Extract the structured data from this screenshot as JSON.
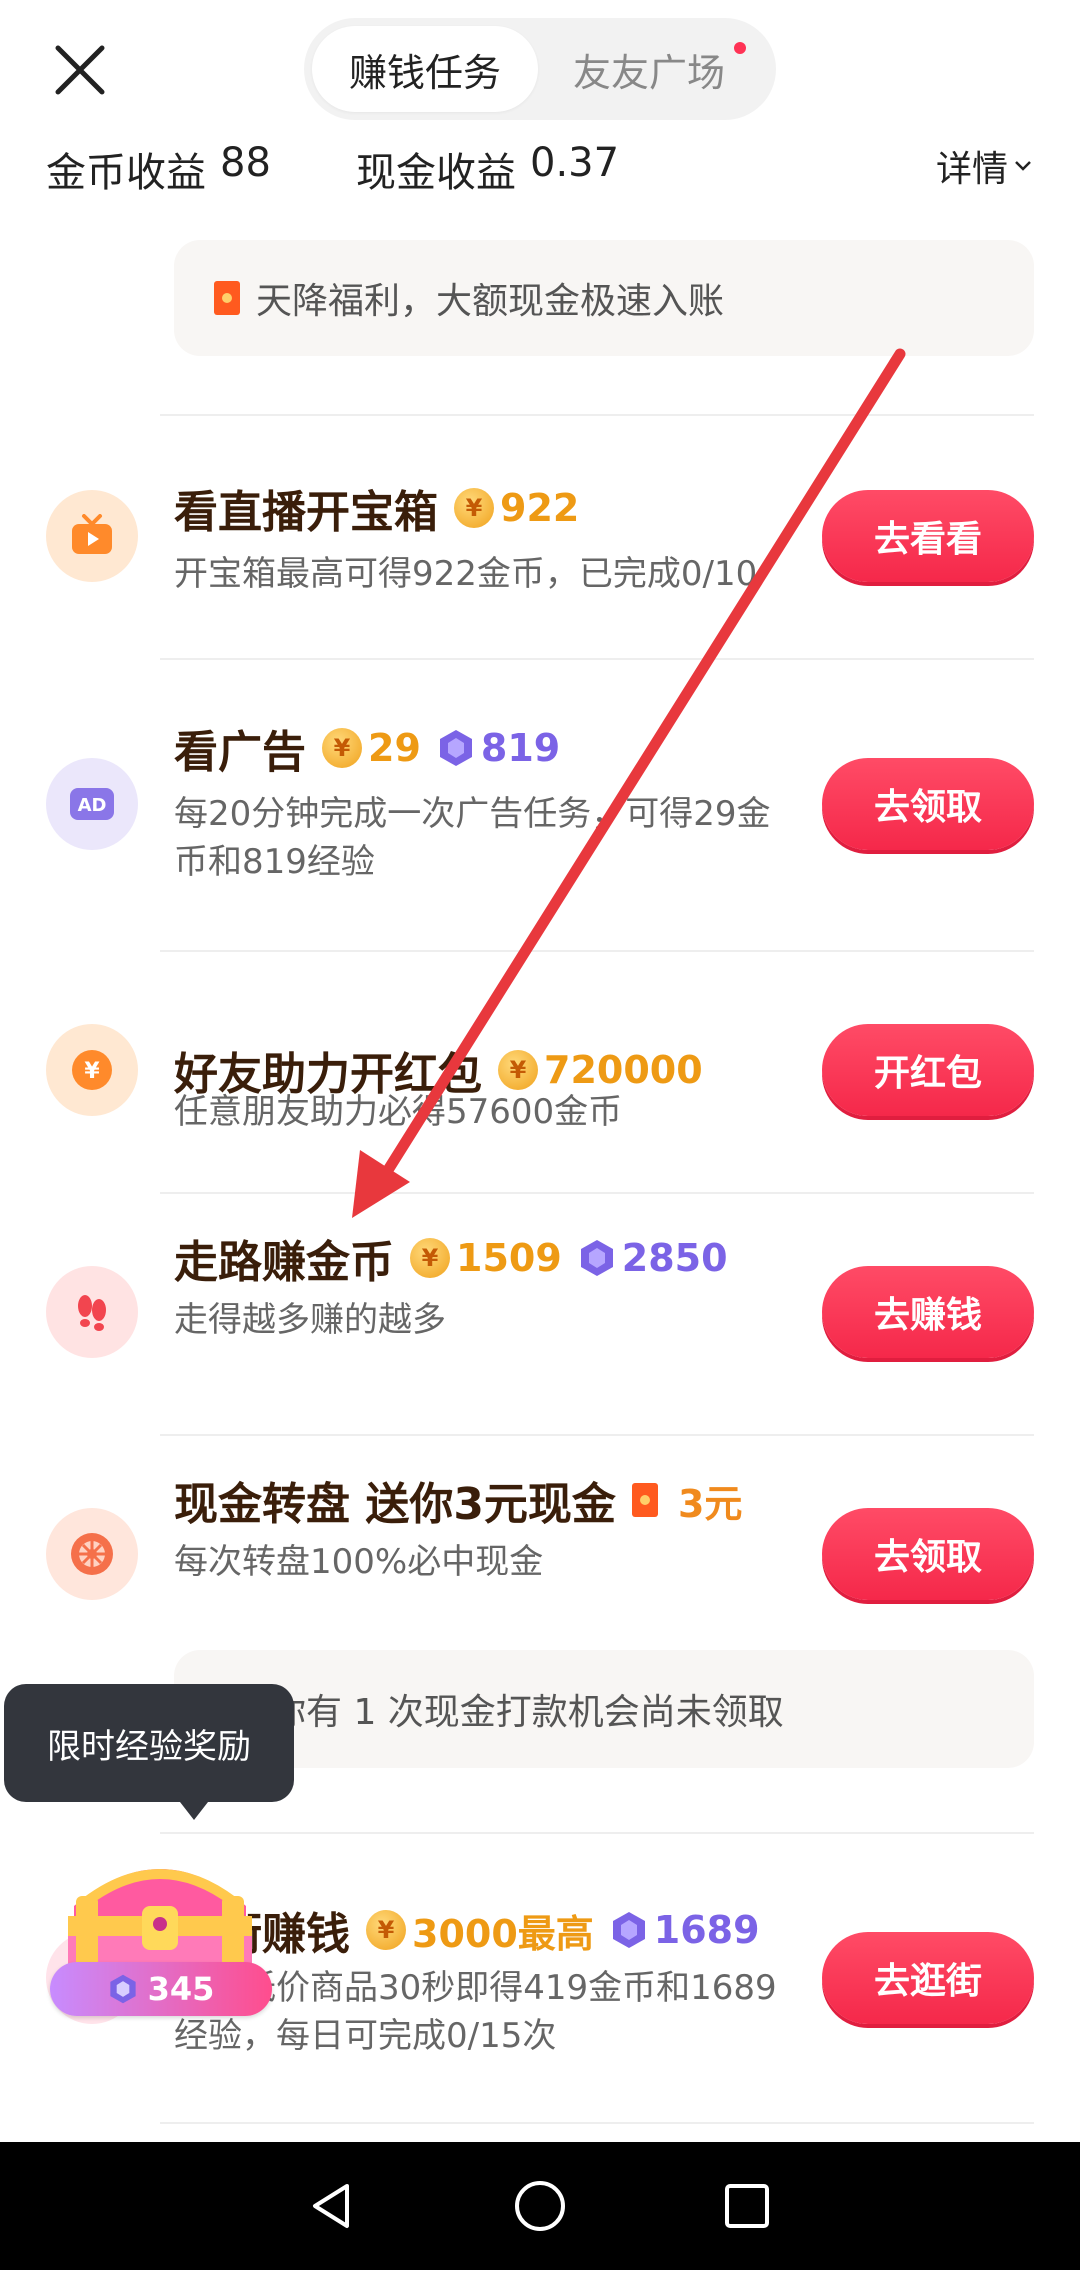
{
  "header": {
    "tabs": [
      {
        "label": "赚钱任务",
        "active": true
      },
      {
        "label": "友友广场",
        "active": false,
        "has_dot": true
      }
    ]
  },
  "earnings": {
    "gold_label": "金币收益",
    "gold_value": "88",
    "cash_label": "现金收益",
    "cash_value": "0.37",
    "detail_label": "详情"
  },
  "notice_top": "天降福利，大额现金极速入账",
  "tasks": [
    {
      "title": "看直播开宝箱",
      "coins": "922",
      "desc": "开宝箱最高可得922金币，已完成0/10",
      "button": "去看看",
      "icon": "tv-icon"
    },
    {
      "title": "看广告",
      "coins": "29",
      "exp": "819",
      "desc": "每20分钟完成一次广告任务，可得29金币和819经验",
      "button": "去领取",
      "icon": "ad-icon"
    },
    {
      "title": "好友助力开红包",
      "coins": "720000",
      "desc": "任意朋友助力必得57600金币",
      "button": "开红包",
      "icon": "yuan-icon"
    },
    {
      "title": "走路赚金币",
      "coins": "1509",
      "exp": "2850",
      "desc": "走得越多赚的越多",
      "button": "去赚钱",
      "icon": "footprints-icon"
    },
    {
      "title": "现金转盘 送你3元现金",
      "cash_reward": "3元",
      "desc": "每次转盘100%必中现金",
      "button": "去领取",
      "icon": "wheel-icon"
    },
    {
      "title": "逛街赚钱",
      "coins": "3000最高",
      "exp": "1689",
      "desc": "浏览低价商品30秒即得419金币和1689经验，每日可完成0/15次",
      "button": "去逛街",
      "icon": "shopping-icon"
    }
  ],
  "notice_mid": "你有 1 次现金打款机会尚未领取",
  "tooltip": "限时经验奖励",
  "chest_exp": "345",
  "colors": {
    "accent_red": "#f5284a",
    "coin_gold": "#ee9a14",
    "exp_purple": "#7b63e6",
    "annotation_arrow": "#e8383d"
  }
}
